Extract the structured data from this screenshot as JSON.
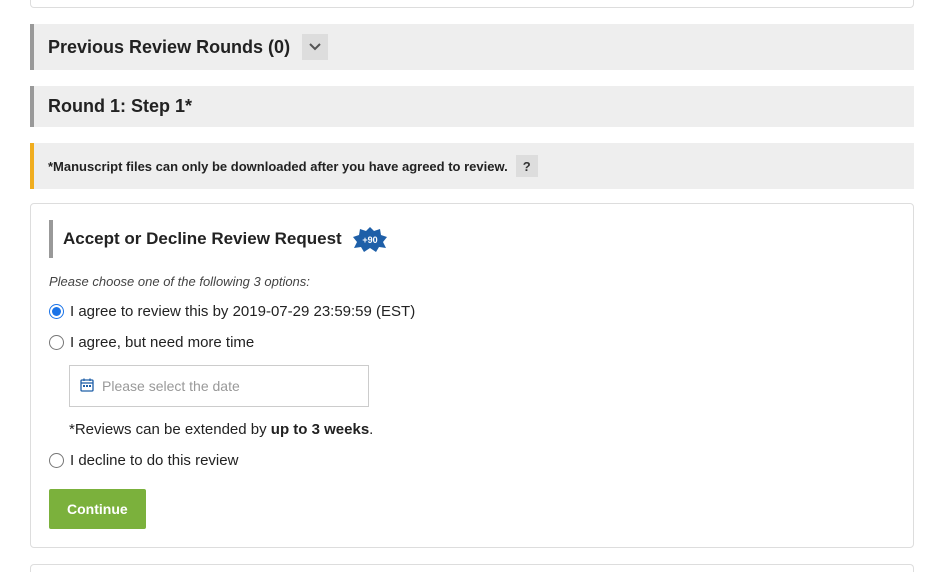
{
  "previousRounds": {
    "label": "Previous Review Rounds (0)"
  },
  "roundHeader": {
    "label": "Round 1: Step 1*"
  },
  "infoBar": {
    "text": "*Manuscript files can only be downloaded after you have agreed to review.",
    "help": "?"
  },
  "section": {
    "title": "Accept or Decline Review Request",
    "badge": "+90"
  },
  "instruction": "Please choose one of the following 3 options:",
  "options": {
    "agree": "I agree to review this by 2019-07-29 23:59:59 (EST)",
    "moreTime": "I agree, but need more time",
    "decline": "I decline to do this review"
  },
  "dateInput": {
    "placeholder": "Please select the date"
  },
  "extendNote": {
    "prefix": "*Reviews can be extended by ",
    "bold": "up to 3 weeks",
    "suffix": "."
  },
  "continueBtn": "Continue"
}
